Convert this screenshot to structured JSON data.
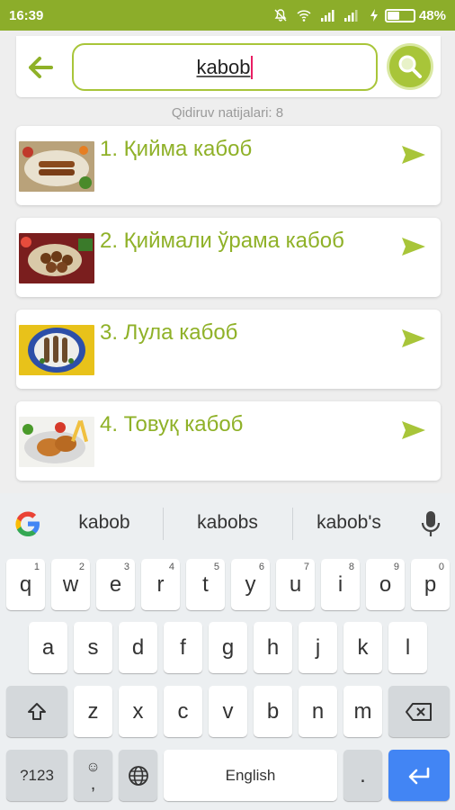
{
  "status_bar": {
    "time": "16:39",
    "battery_percent": "48%",
    "battery_level": 0.48,
    "icons": [
      "mute-icon",
      "wifi-icon",
      "signal-icon",
      "signal-icon",
      "charging-icon"
    ]
  },
  "search": {
    "query": "kabob",
    "results_label": "Qidiruv natijalari: 8"
  },
  "results": [
    {
      "title": "1. Қийма кабоб"
    },
    {
      "title": "2. Қиймали ўрама кабоб"
    },
    {
      "title": "3. Лула кабоб"
    },
    {
      "title": "4. Товуқ кабоб"
    }
  ],
  "keyboard": {
    "suggestions": [
      "kabob",
      "kabobs",
      "kabob's"
    ],
    "row1": [
      {
        "key": "q",
        "hint": "1"
      },
      {
        "key": "w",
        "hint": "2"
      },
      {
        "key": "e",
        "hint": "3"
      },
      {
        "key": "r",
        "hint": "4"
      },
      {
        "key": "t",
        "hint": "5"
      },
      {
        "key": "y",
        "hint": "6"
      },
      {
        "key": "u",
        "hint": "7"
      },
      {
        "key": "i",
        "hint": "8"
      },
      {
        "key": "o",
        "hint": "9"
      },
      {
        "key": "p",
        "hint": "0"
      }
    ],
    "row2": [
      "a",
      "s",
      "d",
      "f",
      "g",
      "h",
      "j",
      "k",
      "l"
    ],
    "row3": [
      "z",
      "x",
      "c",
      "v",
      "b",
      "n",
      "m"
    ],
    "symbols_label": "?123",
    "emoji_label": "☺",
    "comma_label": ",",
    "space_label": "English",
    "period_label": "."
  },
  "colors": {
    "accent": "#8fb128",
    "status_bar": "#8cad2a",
    "enter_key": "#4285f4"
  }
}
